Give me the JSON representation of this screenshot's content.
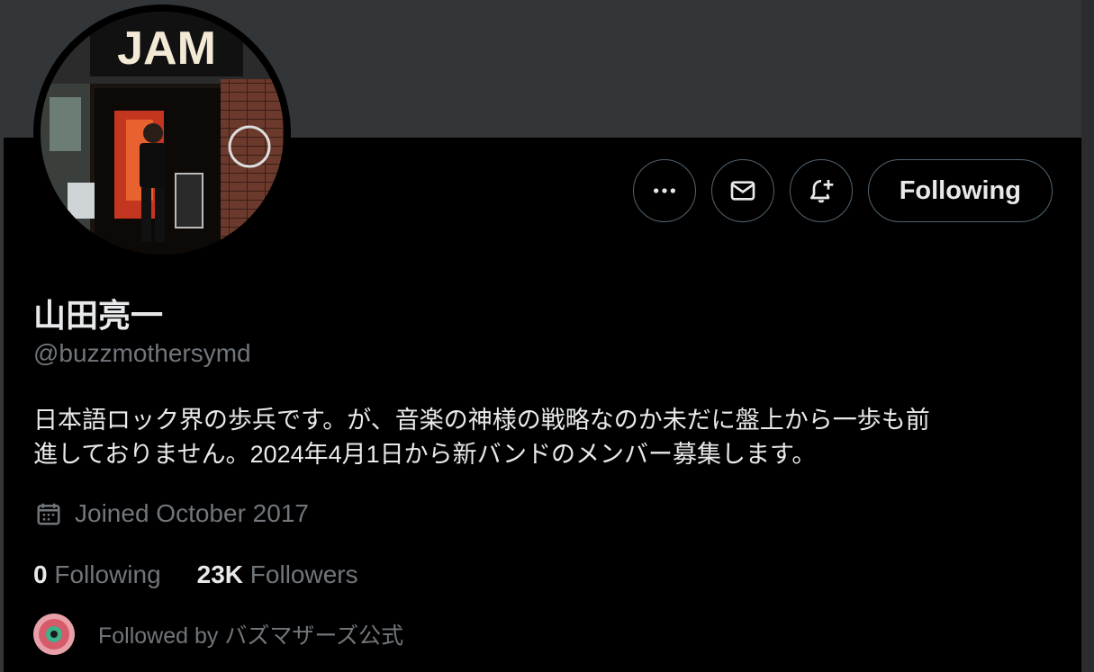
{
  "profile": {
    "display_name": "山田亮一",
    "handle": "@buzzmothersymd",
    "bio_line1": "日本語ロック界の歩兵です。が、音楽の神様の戦略なのか未だに盤上から一歩も前",
    "bio_line2": "進しておりません。2024年4月1日から新バンドのメンバー募集します。",
    "joined": "Joined October 2017",
    "avatar_sign_text": "JAM"
  },
  "actions": {
    "more_icon": "ellipsis-icon",
    "message_icon": "envelope-icon",
    "notify_icon": "bell-plus-icon",
    "follow_label": "Following"
  },
  "stats": {
    "following_count": "0",
    "following_label": "Following",
    "followers_count": "23K",
    "followers_label": "Followers"
  },
  "followed_by": {
    "text": "Followed by バズマザーズ公式"
  },
  "colors": {
    "background": "#000000",
    "banner": "#333639",
    "text_primary": "#e7e9ea",
    "text_secondary": "#71767b",
    "border": "#536471"
  }
}
